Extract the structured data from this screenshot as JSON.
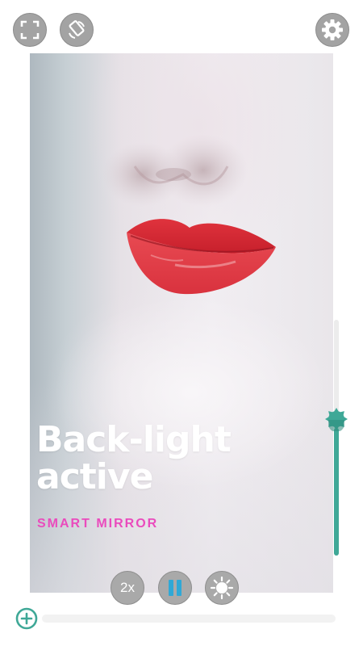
{
  "top_bar": {
    "fullscreen_icon": "fullscreen-icon",
    "rotate_icon": "screen-rotate-icon",
    "settings_icon": "gear-icon"
  },
  "preview": {
    "title_line1": "Back-light",
    "title_line2": "active",
    "subtitle": "SMART MIRROR"
  },
  "controls": {
    "zoom_label": "2x",
    "pause_icon": "pause-icon",
    "brightness_icon": "brightness-icon"
  },
  "brightness_slider": {
    "value": 0.54,
    "icon": "sun-icon",
    "color": "#3fa897"
  },
  "progress_bar": {
    "value": 0.0,
    "add_icon": "plus-circle-icon",
    "color": "#3fa897"
  },
  "colors": {
    "accent": "#3fa897",
    "subtitle": "#ea4bbd",
    "pause_icon": "#2fa8d6"
  }
}
